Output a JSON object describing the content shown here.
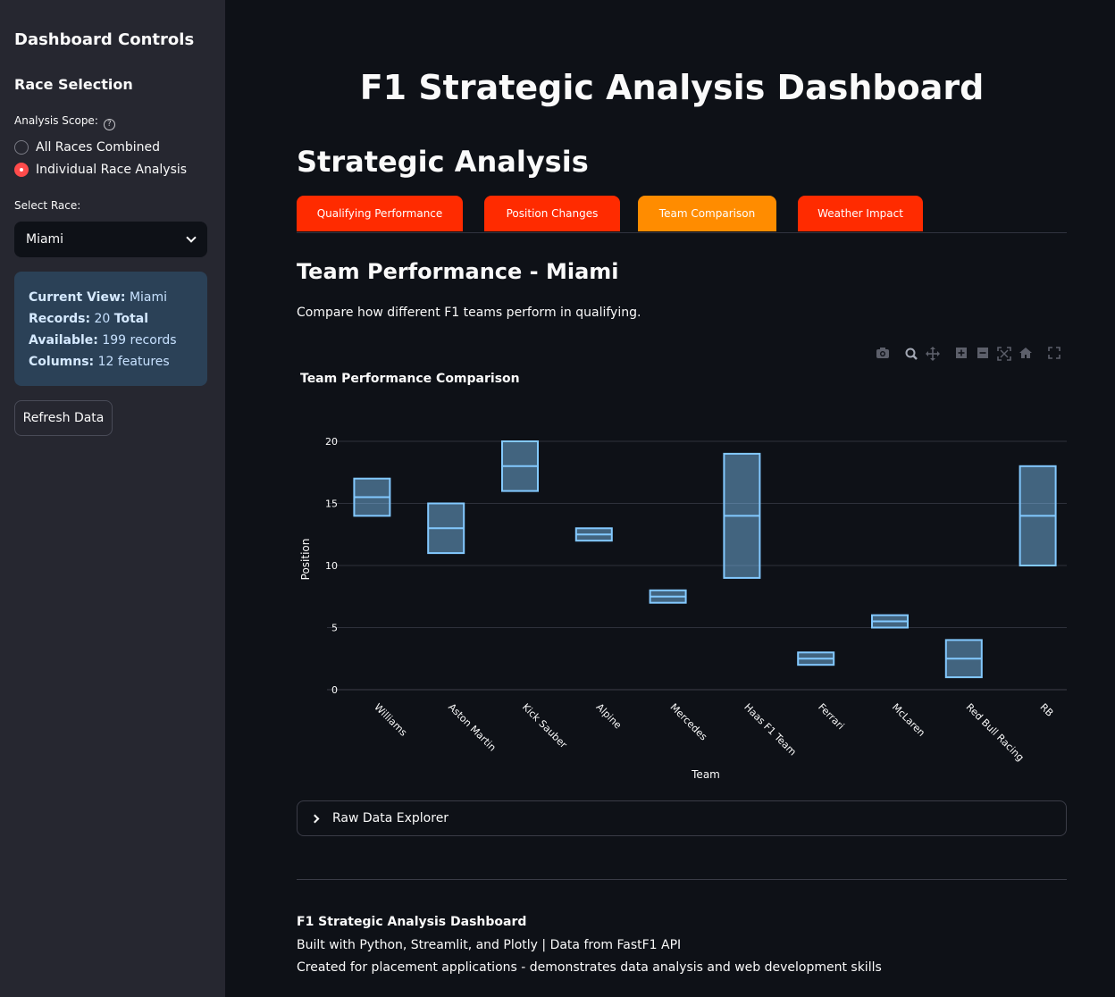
{
  "sidebar": {
    "title": "Dashboard Controls",
    "section": "Race Selection",
    "scope_label": "Analysis Scope:",
    "scope_options": [
      "All Races Combined",
      "Individual Race Analysis"
    ],
    "scope_selected": "Individual Race Analysis",
    "race_label": "Select Race:",
    "race_value": "Miami",
    "info": {
      "current_view_label": "Current View:",
      "current_view_value": "Miami",
      "records_label": "Records:",
      "records_value": "20",
      "total_label": "Total",
      "available_label": "Available:",
      "available_value": "199 records",
      "columns_label": "Columns:",
      "columns_value": "12 features"
    },
    "refresh_label": "Refresh Data"
  },
  "main": {
    "title": "F1 Strategic Analysis Dashboard",
    "section_title": "Strategic Analysis",
    "tabs": [
      {
        "label": "Qualifying Performance",
        "active": false
      },
      {
        "label": "Position Changes",
        "active": false
      },
      {
        "label": "Team Comparison",
        "active": true
      },
      {
        "label": "Weather Impact",
        "active": false
      }
    ],
    "subtitle": "Team Performance - Miami",
    "description": "Compare how different F1 teams perform in qualifying.",
    "modebar_icons": [
      "camera-icon",
      "zoom-icon",
      "pan-icon",
      "zoom-in-icon",
      "zoom-out-icon",
      "autoscale-icon",
      "home-icon",
      "fullscreen-icon"
    ],
    "expander_label": "Raw Data Explorer"
  },
  "chart_data": {
    "type": "box",
    "title": "Team Performance Comparison",
    "xlabel": "Team",
    "ylabel": "Position",
    "ylim": [
      -0.5,
      21
    ],
    "yticks": [
      0,
      5,
      10,
      15,
      20
    ],
    "grid": true,
    "color": "#83c9ff",
    "categories": [
      "Williams",
      "Aston Martin",
      "Kick Sauber",
      "Alpine",
      "Mercedes",
      "Haas F1 Team",
      "Ferrari",
      "McLaren",
      "Red Bull Racing",
      "RB"
    ],
    "boxes": [
      {
        "low": 14,
        "median": 15.5,
        "high": 17
      },
      {
        "low": 11,
        "median": 13,
        "high": 15
      },
      {
        "low": 16,
        "median": 18,
        "high": 20
      },
      {
        "low": 12,
        "median": 12.5,
        "high": 13
      },
      {
        "low": 7,
        "median": 7.5,
        "high": 8
      },
      {
        "low": 9,
        "median": 14,
        "high": 19
      },
      {
        "low": 2,
        "median": 2.5,
        "high": 3
      },
      {
        "low": 5,
        "median": 5.5,
        "high": 6
      },
      {
        "low": 1,
        "median": 2.5,
        "high": 4
      },
      {
        "low": 10,
        "median": 14,
        "high": 18
      }
    ]
  },
  "footer": {
    "title": "F1 Strategic Analysis Dashboard",
    "line1": "Built with Python, Streamlit, and Plotly | Data from FastF1 API",
    "line2": "Created for placement applications - demonstrates data analysis and web development skills"
  }
}
